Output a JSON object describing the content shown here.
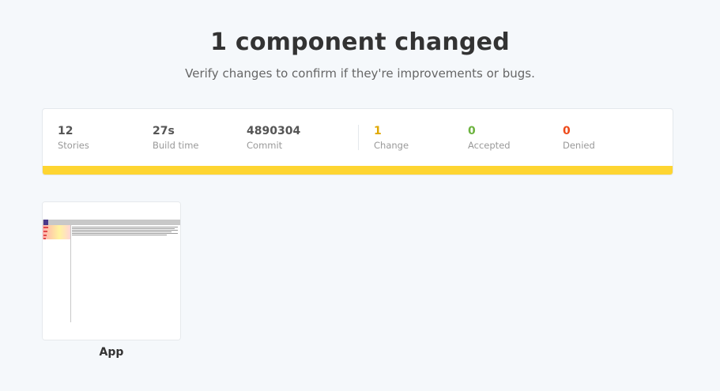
{
  "header": {
    "title": "1 component changed",
    "subtitle": "Verify changes to confirm if they're improvements or bugs."
  },
  "stats": [
    {
      "value": "12",
      "label": "Stories",
      "color": "#555555"
    },
    {
      "value": "27s",
      "label": "Build time",
      "color": "#555555"
    },
    {
      "value": "4890304",
      "label": "Commit",
      "color": "#555555"
    },
    {
      "value": "1",
      "label": "Change",
      "color": "#e0a800"
    },
    {
      "value": "0",
      "label": "Accepted",
      "color": "#6cb33f"
    },
    {
      "value": "0",
      "label": "Denied",
      "color": "#ee4a1a"
    }
  ],
  "status_color": "#fed531",
  "components": [
    {
      "name": "App"
    }
  ]
}
